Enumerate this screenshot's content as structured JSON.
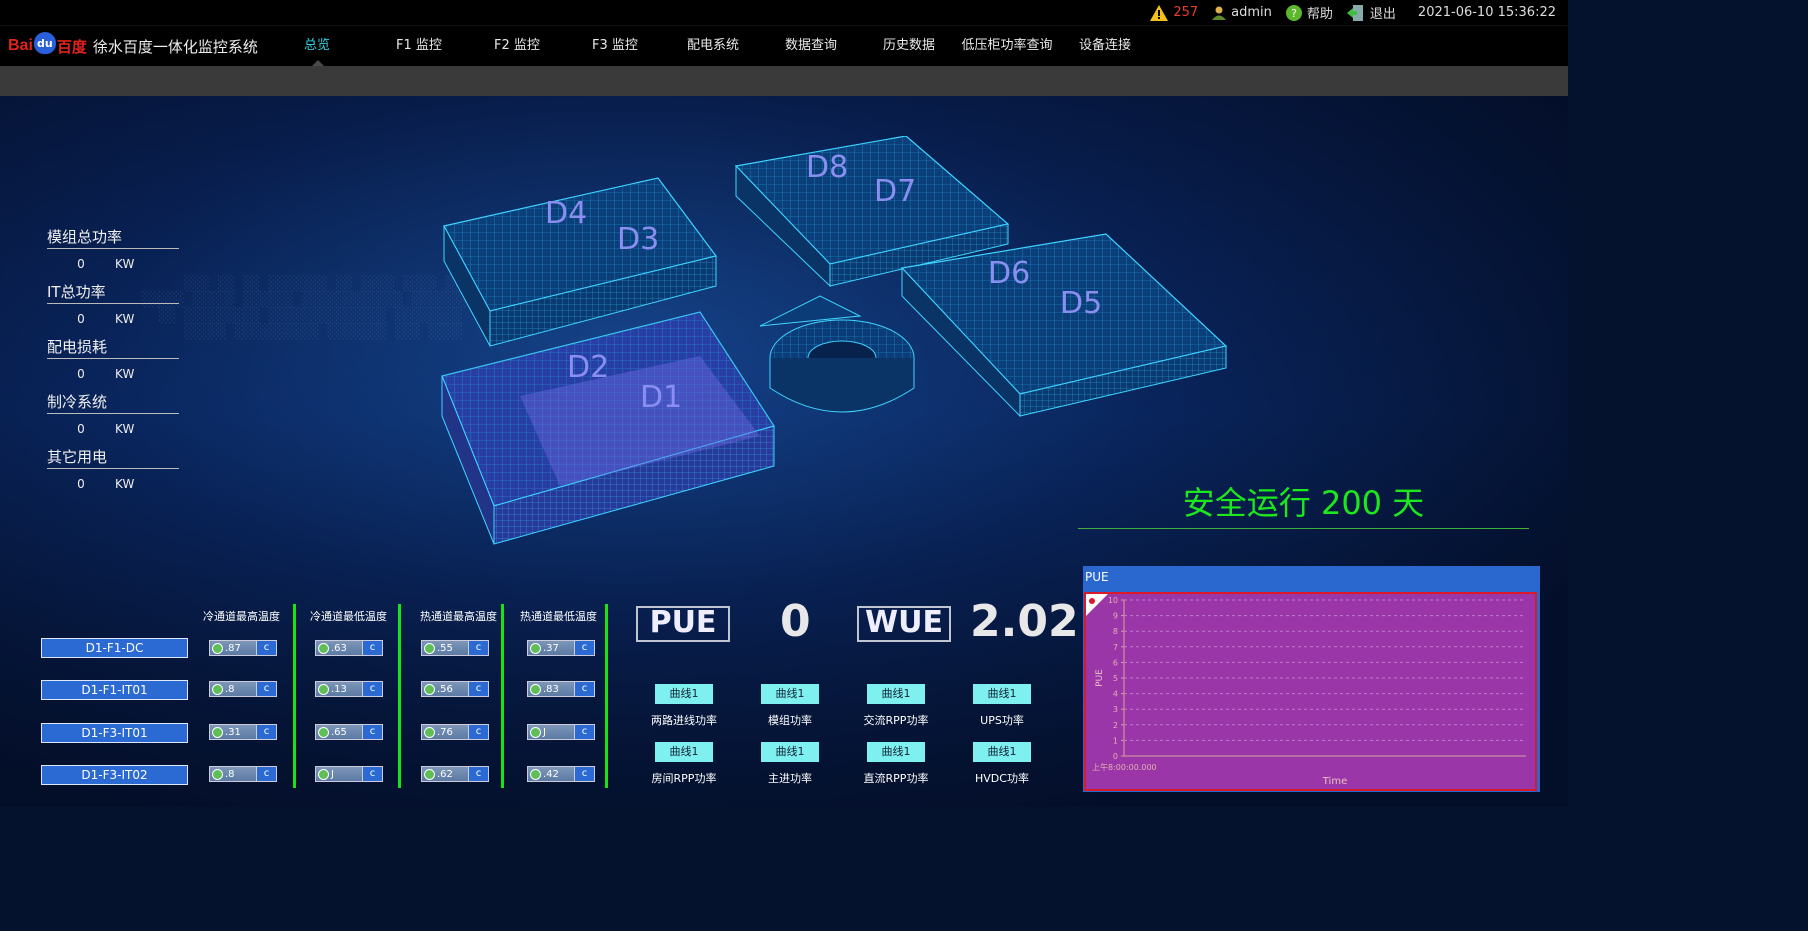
{
  "topbar": {
    "alarm_count": "257",
    "user": "admin",
    "help": "帮助",
    "logout": "退出",
    "datetime": "2021-06-10 15:36:22"
  },
  "brand": {
    "logo_bai": "Bai",
    "logo_du": "du",
    "logo_cn": "百度",
    "system_name": "徐水百度一体化监控系统"
  },
  "nav": [
    "总览",
    "F1 监控",
    "F2 监控",
    "F3 监控",
    "配电系统",
    "数据查询",
    "历史数据",
    "低压柜功率查询",
    "设备连接"
  ],
  "stats": [
    {
      "label": "模组总功率",
      "value": "0",
      "unit": "KW"
    },
    {
      "label": "IT总功率",
      "value": "0",
      "unit": "KW"
    },
    {
      "label": "配电损耗",
      "value": "0",
      "unit": "KW"
    },
    {
      "label": "制冷系统",
      "value": "0",
      "unit": "KW"
    },
    {
      "label": "其它用电",
      "value": "0",
      "unit": "KW"
    }
  ],
  "buildings": [
    "D4",
    "D3",
    "D8",
    "D7",
    "D6",
    "D5",
    "D2",
    "D1"
  ],
  "safe_run": "安全运行 200 天",
  "temp_columns": [
    "冷通道最高温度",
    "冷通道最低温度",
    "热通道最高温度",
    "热通道最低温度"
  ],
  "devices": [
    {
      "name": "D1-F1-DC",
      "values": [
        ".87",
        ".63",
        ".55",
        ".37"
      ]
    },
    {
      "name": "D1-F1-IT01",
      "values": [
        ".8",
        ".13",
        ".56",
        ".83"
      ]
    },
    {
      "name": "D1-F3-IT01",
      "values": [
        ".31",
        ".65",
        ".76",
        "J"
      ]
    },
    {
      "name": "D1-F3-IT02",
      "values": [
        ".8",
        "J",
        ".62",
        ".42"
      ]
    }
  ],
  "temp_unit": "c",
  "metrics": {
    "pue_label": "PUE",
    "pue_value": "0",
    "wue_label": "WUE",
    "wue_value": "2.02"
  },
  "curves": [
    {
      "button": "曲线1",
      "label": "两路进线功率"
    },
    {
      "button": "曲线1",
      "label": "模组功率"
    },
    {
      "button": "曲线1",
      "label": "交流RPP功率"
    },
    {
      "button": "曲线1",
      "label": "UPS功率"
    },
    {
      "button": "曲线1",
      "label": "房间RPP功率"
    },
    {
      "button": "曲线1",
      "label": "主进功率"
    },
    {
      "button": "曲线1",
      "label": "直流RPP功率"
    },
    {
      "button": "曲线1",
      "label": "HVDC功率"
    }
  ],
  "pue_chart": {
    "title": "PUE",
    "chart_data": {
      "type": "line",
      "title": "PUE",
      "xlabel": "Time",
      "ylabel": "PUE",
      "x": [
        "上午8:00:00.000"
      ],
      "series": [],
      "ylim": [
        0,
        10
      ],
      "yticks": [
        "0",
        "1",
        "2",
        "3",
        "4",
        "5",
        "6",
        "7",
        "8",
        "9",
        "10"
      ],
      "grid": true
    }
  },
  "colors": {
    "accent_nav": "#2fd0e0",
    "safe_run": "#1de81d",
    "separator": "#19e219",
    "chart_bg": "#9a36a8",
    "chart_border": "#d91a2a",
    "device_button": "#2a6ad2"
  }
}
